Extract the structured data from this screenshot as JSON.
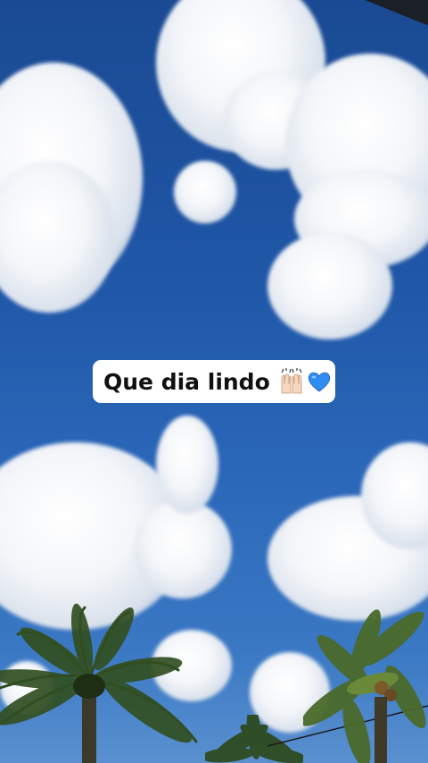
{
  "caption": {
    "text": "Que dia lindo",
    "emoji_icons": [
      "raising-hands-icon",
      "blue-heart-icon"
    ]
  },
  "colors": {
    "sky": "#1f56a6",
    "cloud": "#f4f6f9",
    "caption_bg": "#ffffff",
    "heart": "#2f8cf0",
    "palm": "#2f4a1f"
  }
}
